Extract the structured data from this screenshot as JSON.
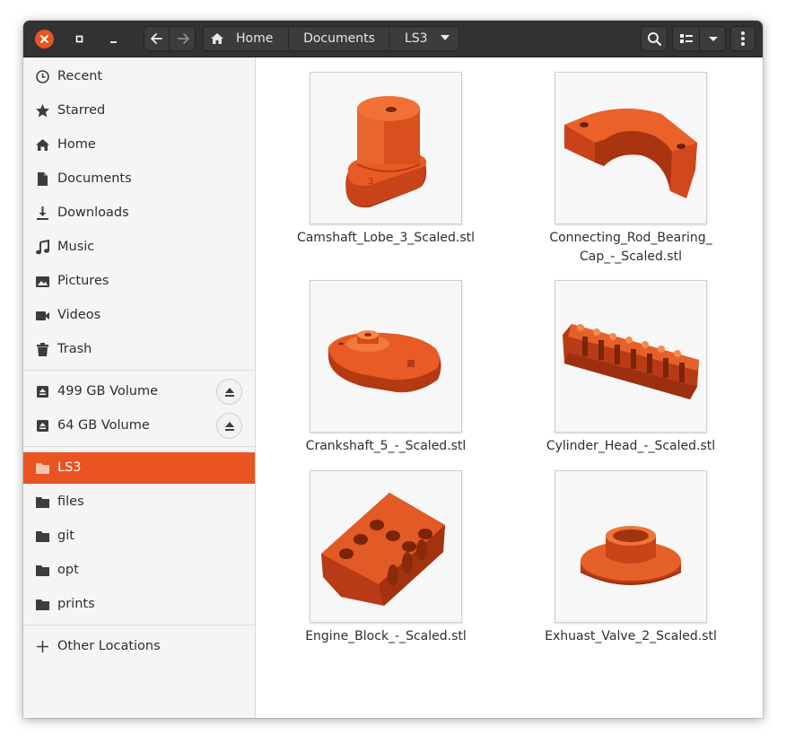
{
  "window": {
    "controls": {
      "close_icon": "close-icon",
      "maximize_icon": "maximize-icon",
      "minimize_icon": "minimize-icon"
    },
    "accent_color": "#e95420"
  },
  "pathbar": {
    "home": "Home",
    "documents": "Documents",
    "current": "LS3"
  },
  "sidebar": {
    "places": [
      {
        "label": "Recent",
        "icon": "clock-icon"
      },
      {
        "label": "Starred",
        "icon": "star-icon"
      },
      {
        "label": "Home",
        "icon": "home-icon"
      },
      {
        "label": "Documents",
        "icon": "document-icon"
      },
      {
        "label": "Downloads",
        "icon": "download-icon"
      },
      {
        "label": "Music",
        "icon": "music-icon"
      },
      {
        "label": "Pictures",
        "icon": "picture-icon"
      },
      {
        "label": "Videos",
        "icon": "video-icon"
      },
      {
        "label": "Trash",
        "icon": "trash-icon"
      }
    ],
    "volumes": [
      {
        "label": "499 GB Volume",
        "icon": "drive-icon"
      },
      {
        "label": "64 GB Volume",
        "icon": "drive-icon"
      }
    ],
    "bookmarks": [
      {
        "label": "LS3",
        "icon": "folder-icon",
        "active": true
      },
      {
        "label": "files",
        "icon": "folder-icon"
      },
      {
        "label": "git",
        "icon": "folder-icon"
      },
      {
        "label": "opt",
        "icon": "folder-icon"
      },
      {
        "label": "prints",
        "icon": "folder-icon"
      }
    ],
    "other_locations": "Other Locations"
  },
  "files": [
    {
      "name": "Camshaft_Lobe_3_Scaled.stl",
      "line2": ""
    },
    {
      "name": "Connecting_Rod_Bearing_",
      "line2": "Cap_-_Scaled.stl"
    },
    {
      "name": "Crankshaft_5_-_Scaled.stl",
      "line2": ""
    },
    {
      "name": "Cylinder_Head_-_Scaled.stl",
      "line2": ""
    },
    {
      "name": "Engine_Block_-_Scaled.stl",
      "line2": ""
    },
    {
      "name": "Exhuast_Valve_2_Scaled.stl",
      "line2": ""
    }
  ]
}
